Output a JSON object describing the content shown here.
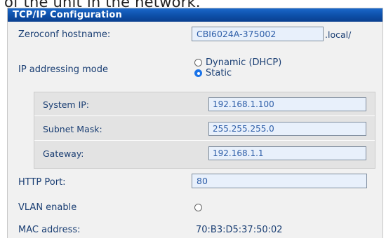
{
  "intro_fragment": "of the unit in the network.",
  "panel": {
    "title": "TCP/IP Configuration",
    "hostname": {
      "label": "Zeroconf hostname:",
      "value": "CBI6024A-375002",
      "suffix": ".local/"
    },
    "ip_mode": {
      "label": "IP addressing mode",
      "options": [
        {
          "label": "Dynamic (DHCP)",
          "selected": false
        },
        {
          "label": "Static",
          "selected": true
        }
      ]
    },
    "static_settings": [
      {
        "label": "System IP:",
        "value": "192.168.1.100"
      },
      {
        "label": "Subnet Mask:",
        "value": "255.255.255.0"
      },
      {
        "label": "Gateway:",
        "value": "192.168.1.1"
      }
    ],
    "http_port": {
      "label": "HTTP Port:",
      "value": "80"
    },
    "vlan": {
      "label": "VLAN enable",
      "enabled": false
    },
    "mac": {
      "label": "MAC address:",
      "value": "70:B3:D5:37:50:02"
    }
  },
  "colors": {
    "header_blue": "#0d4fa8",
    "label_navy": "#1a3e73",
    "input_bg": "#e8f0fb",
    "input_text": "#2e5ea8",
    "radio_selected": "#1a73e8"
  }
}
